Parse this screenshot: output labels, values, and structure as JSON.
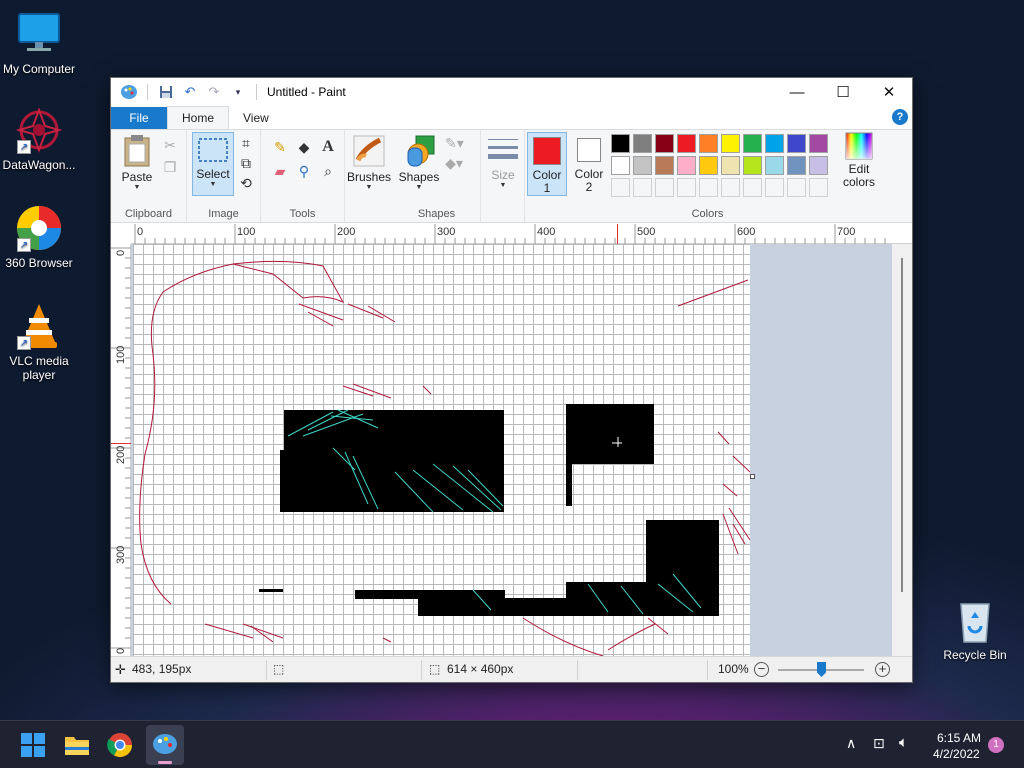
{
  "desktop": {
    "icons": [
      {
        "label": "My Computer",
        "icon": "monitor-icon"
      },
      {
        "label": "DataWagon...",
        "icon": "datawagon-icon"
      },
      {
        "label": "360 Browser",
        "icon": "360-browser-icon"
      },
      {
        "label": "VLC media player",
        "icon": "vlc-icon"
      },
      {
        "label": "Recycle Bin",
        "icon": "recycle-bin-icon"
      }
    ]
  },
  "window": {
    "title": "Untitled - Paint",
    "controls": {
      "minimize": "—",
      "maximize": "☐",
      "close": "✕"
    }
  },
  "tabs": {
    "file": "File",
    "home": "Home",
    "view": "View",
    "help": "?"
  },
  "ribbon": {
    "clipboard": {
      "paste": "Paste",
      "group_label": "Clipboard"
    },
    "image": {
      "select": "Select",
      "group_label": "Image"
    },
    "tools": {
      "group_label": "Tools"
    },
    "brushes": {
      "label": "Brushes"
    },
    "shapes": {
      "label": "Shapes",
      "group_label": "Shapes"
    },
    "size": {
      "label": "Size"
    },
    "colors": {
      "color1_line1": "Color",
      "color1_line2": "1",
      "color2_line1": "Color",
      "color2_line2": "2",
      "edit_line1": "Edit",
      "edit_line2": "colors",
      "group_label": "Colors",
      "color1_value": "#ed1c24",
      "color2_value": "#ffffff",
      "palette_row1": [
        "#000000",
        "#7f7f7f",
        "#880015",
        "#ed1c24",
        "#ff7f27",
        "#fff200",
        "#22b14c",
        "#00a2e8",
        "#3f48cc",
        "#a349a4"
      ],
      "palette_row2": [
        "#ffffff",
        "#c3c3c3",
        "#b97a57",
        "#ffaec9",
        "#ffc90e",
        "#efe4b0",
        "#b5e61d",
        "#99d9ea",
        "#7092be",
        "#c8bfe7"
      ],
      "palette_row3": [
        "",
        "",
        "",
        "",
        "",
        "",
        "",
        "",
        "",
        ""
      ]
    }
  },
  "ruler": {
    "h": [
      "0",
      "100",
      "200",
      "300",
      "400",
      "500",
      "600",
      "700"
    ],
    "v": [
      "0",
      "100",
      "200",
      "300",
      "0"
    ]
  },
  "status": {
    "cursor_pos": "483, 195px",
    "selection": "",
    "canvas_size": "614 × 460px",
    "zoom": "100%"
  },
  "taskbar": {
    "time": "6:15 AM",
    "date": "4/2/2022",
    "notifications": "1"
  }
}
